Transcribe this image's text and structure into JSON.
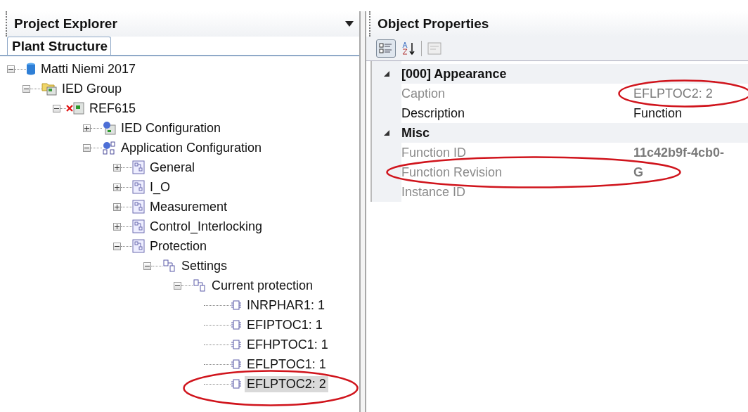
{
  "explorer": {
    "title": "Project Explorer",
    "tabs": [
      {
        "label": "Plant Structure",
        "selected": true
      }
    ],
    "tree": [
      {
        "label": "Matti Niemi 2017",
        "kind": "database",
        "expanded": true,
        "children": [
          {
            "label": "IED Group",
            "kind": "group",
            "expanded": true,
            "children": [
              {
                "label": "REF615",
                "kind": "device",
                "error": true,
                "expanded": true,
                "children": [
                  {
                    "label": "IED Configuration",
                    "kind": "config",
                    "expanded": false
                  },
                  {
                    "label": "Application Configuration",
                    "kind": "appconfig",
                    "expanded": true,
                    "children": [
                      {
                        "label": "General",
                        "kind": "diagram",
                        "expanded": false
                      },
                      {
                        "label": "I_O",
                        "kind": "diagram",
                        "expanded": false
                      },
                      {
                        "label": "Measurement",
                        "kind": "diagram",
                        "expanded": false
                      },
                      {
                        "label": "Control_Interlocking",
                        "kind": "diagram",
                        "expanded": false
                      },
                      {
                        "label": "Protection",
                        "kind": "diagram",
                        "expanded": true,
                        "children": [
                          {
                            "label": "Settings",
                            "kind": "settings",
                            "expanded": true,
                            "children": [
                              {
                                "label": "Current protection",
                                "kind": "settings",
                                "expanded": true,
                                "children": [
                                  {
                                    "label": "INRPHAR1: 1",
                                    "kind": "function",
                                    "selected": false,
                                    "circled": false
                                  },
                                  {
                                    "label": "EFIPTOC1: 1",
                                    "kind": "function",
                                    "selected": false,
                                    "circled": false
                                  },
                                  {
                                    "label": "EFHPTOC1: 1",
                                    "kind": "function",
                                    "selected": false,
                                    "circled": false
                                  },
                                  {
                                    "label": "EFLPTOC1: 1",
                                    "kind": "function",
                                    "selected": false,
                                    "circled": false
                                  },
                                  {
                                    "label": "EFLPTOC2: 2",
                                    "kind": "function",
                                    "selected": true,
                                    "circled": true
                                  }
                                ]
                              }
                            ]
                          }
                        ]
                      }
                    ]
                  }
                ]
              }
            ]
          }
        ]
      }
    ]
  },
  "properties": {
    "title": "Object Properties",
    "toolbar": [
      {
        "kind": "categorized",
        "selected": true
      },
      {
        "kind": "alphabetical",
        "selected": false
      },
      {
        "kind": "pages",
        "selected": false
      }
    ],
    "categories": [
      {
        "name": "[000] Appearance",
        "expanded": true,
        "rows": [
          {
            "name": "Caption",
            "value": "EFLPTOC2: 2",
            "readonly": true,
            "bold": false,
            "name_circled": false,
            "value_circled": true
          },
          {
            "name": "Description",
            "value": "Function",
            "readonly": false,
            "bold": false,
            "name_circled": false,
            "value_circled": false
          }
        ]
      },
      {
        "name": "Misc",
        "expanded": true,
        "rows": [
          {
            "name": "Function ID",
            "value": "11c42b9f-4cb0-",
            "readonly": true,
            "bold": true,
            "name_circled": false,
            "value_circled": false
          },
          {
            "name": "Function Revision",
            "value": "G",
            "readonly": true,
            "bold": true,
            "name_circled": true,
            "value_circled": true
          },
          {
            "name": "Instance ID",
            "readonly": true,
            "name_circled": false
          }
        ]
      }
    ]
  }
}
